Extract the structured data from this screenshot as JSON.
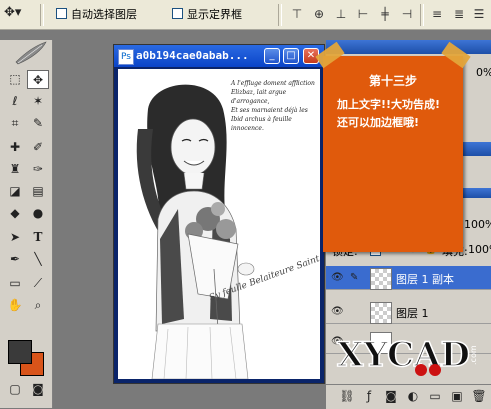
{
  "options_bar": {
    "auto_select_label": "自动选择图层",
    "show_bounds_label": "显示定界框"
  },
  "document": {
    "title": "a0b194cae0abab...",
    "poem_lines": [
      "A l'effluge doment affliction",
      "Elizbaz, lait argue d'arrogance,",
      "Et ses marnaient déjà les",
      "Ibid archus à feuille innocence."
    ],
    "signature": "Sy feulle Belaiteure Saint"
  },
  "note": {
    "heading": "第十三步",
    "line1": "加上文字!!大功告成!",
    "line2": "还可以加边框哦!"
  },
  "layers_panel": {
    "lock_label": "锁定:",
    "fill_label": "填充:",
    "fill_value": "100%",
    "opacity_value": "100%",
    "top_value": "0%",
    "layers": [
      {
        "name": "图层 1 副本",
        "selected": true
      },
      {
        "name": "图层 1",
        "selected": false
      }
    ]
  },
  "watermark": {
    "brand": "XYCAD",
    "suffix": ".com"
  },
  "colors": {
    "note_bg": "#e05a0c",
    "foreground": "#3a3a3a",
    "background": "#d8541a",
    "titlebar": "#0a44c8"
  }
}
